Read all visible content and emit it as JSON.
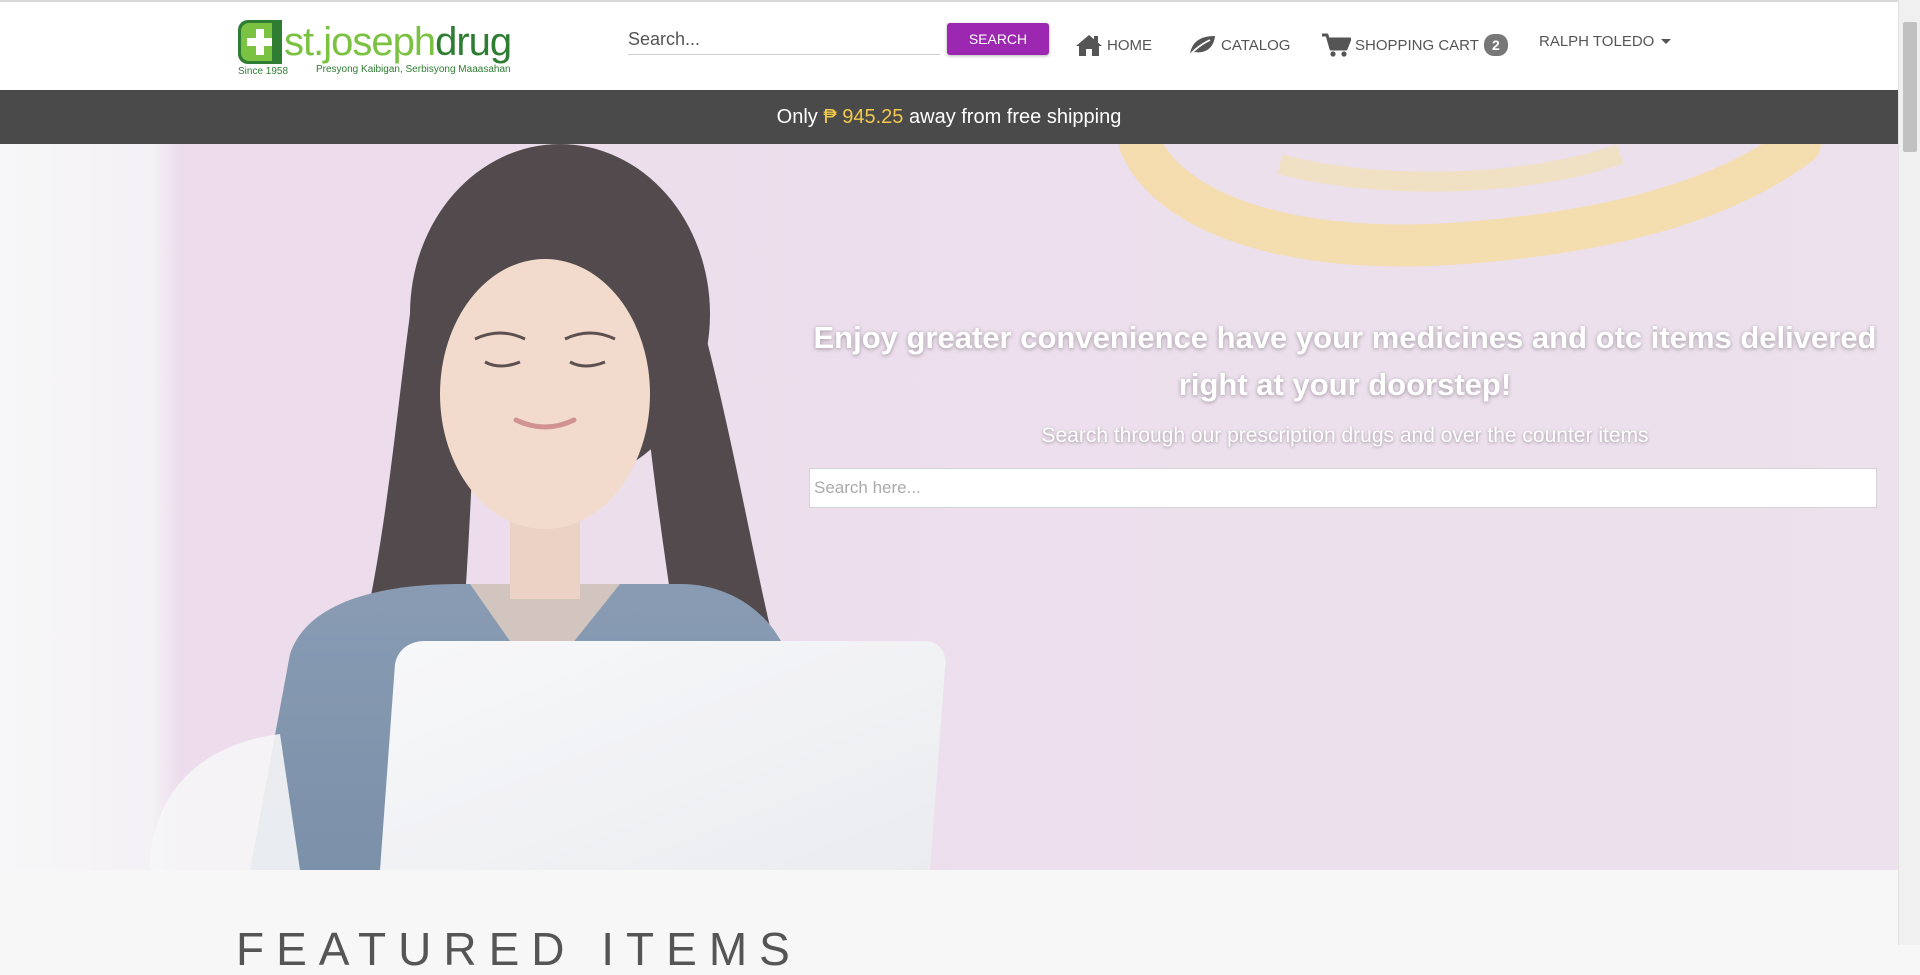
{
  "header": {
    "logo": {
      "brand_part1": "st.joseph",
      "brand_part2": "drug",
      "since": "Since 1958",
      "tagline": "Presyong Kaibigan, Serbisyong Maaasahan"
    },
    "search": {
      "placeholder": "Search...",
      "button_label": "SEARCH"
    },
    "nav": {
      "home": "HOME",
      "catalog": "CATALOG",
      "cart": "SHOPPING CART",
      "cart_count": "2",
      "user": "RALPH TOLEDO"
    }
  },
  "promo": {
    "prefix": "Only",
    "amount": "₱ 945.25",
    "suffix": "away from free shipping"
  },
  "hero": {
    "title": "Enjoy greater convenience have your medicines and otc items delivered right at your doorstep!",
    "subtitle": "Search through our prescription drugs and over the counter items",
    "search_placeholder": "Search here..."
  },
  "featured": {
    "heading": "FEATURED ITEMS"
  },
  "colors": {
    "accent": "#9c27b0",
    "promo_bar": "#4a4a4a",
    "promo_amount": "#f2c94c",
    "logo_light": "#7cc242",
    "logo_dark": "#2e7d32"
  },
  "icons": [
    "home-icon",
    "leaf-icon",
    "cart-icon",
    "caret-down-icon",
    "logo-cross-icon"
  ]
}
